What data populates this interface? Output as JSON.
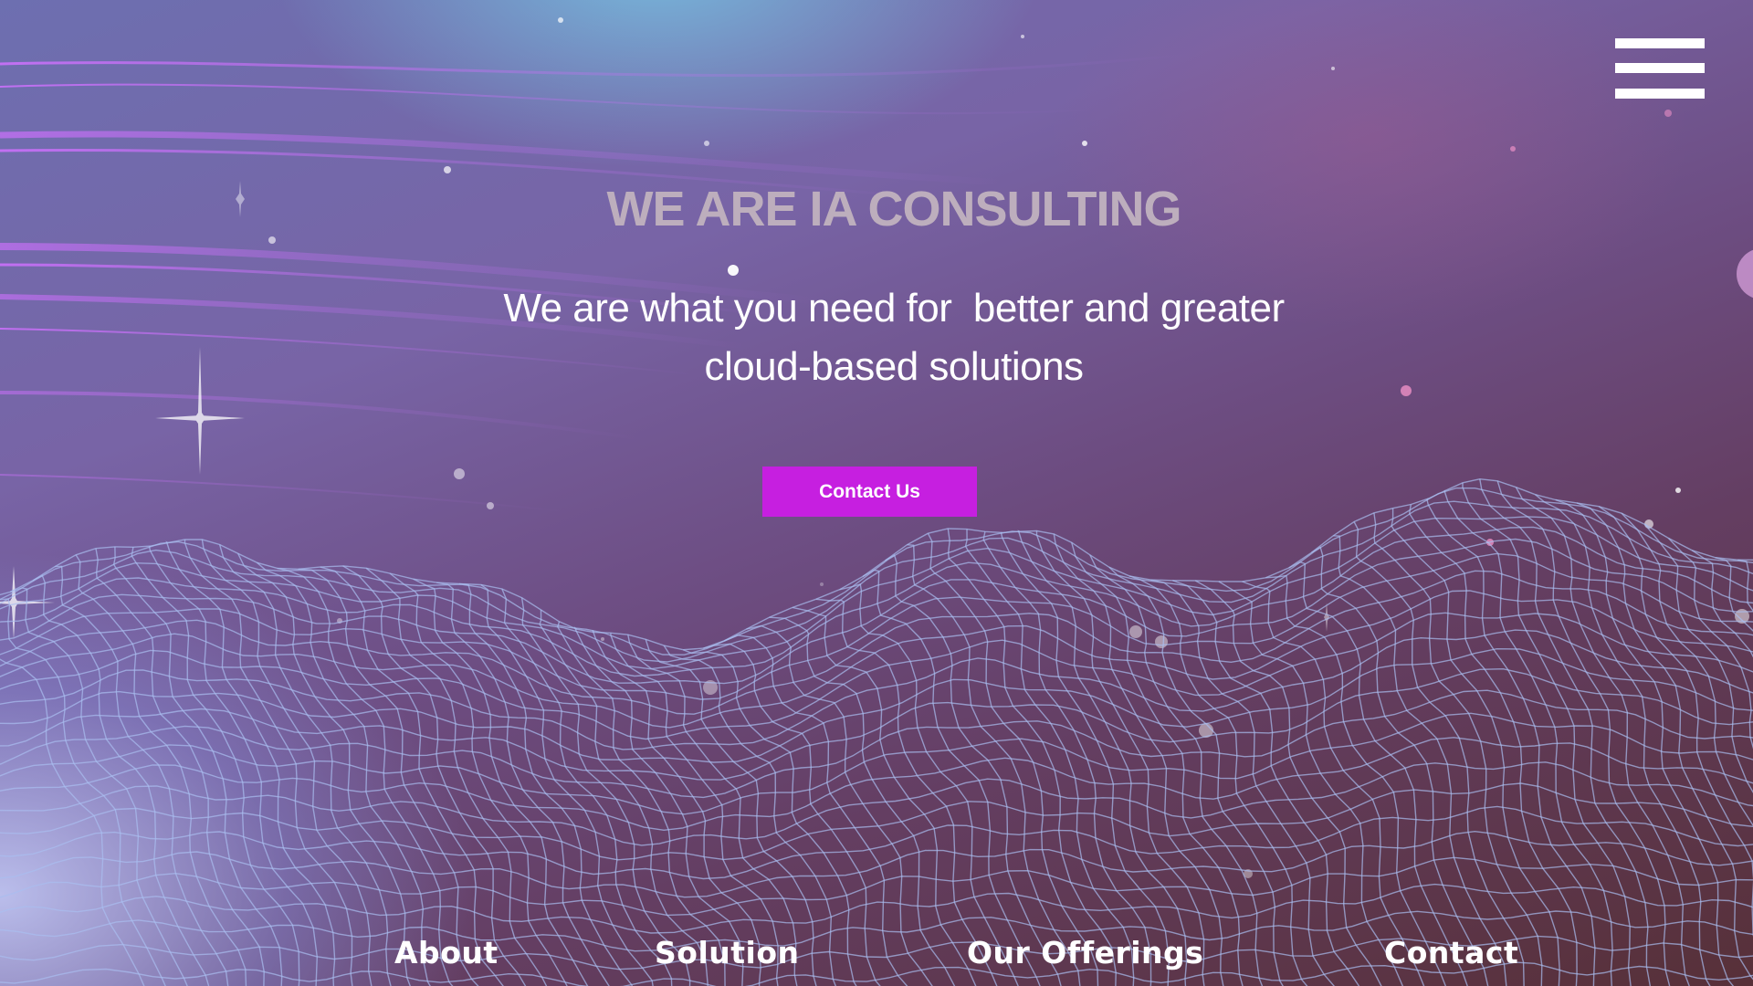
{
  "hero": {
    "title": "WE ARE IA CONSULTING",
    "subtitle_line1": "We are what you need for  better and greater",
    "subtitle_line2": "cloud-based solutions",
    "cta_label": "Contact Us"
  },
  "header": {
    "menu_icon": "hamburger-menu-icon"
  },
  "footer_nav": {
    "items": [
      {
        "label": "About"
      },
      {
        "label": "Solution"
      },
      {
        "label": "Our Offerings"
      },
      {
        "label": "Contact"
      }
    ]
  },
  "colors": {
    "accent": "#c61fe0",
    "title": "#bdaebd",
    "text": "#ffffff"
  }
}
